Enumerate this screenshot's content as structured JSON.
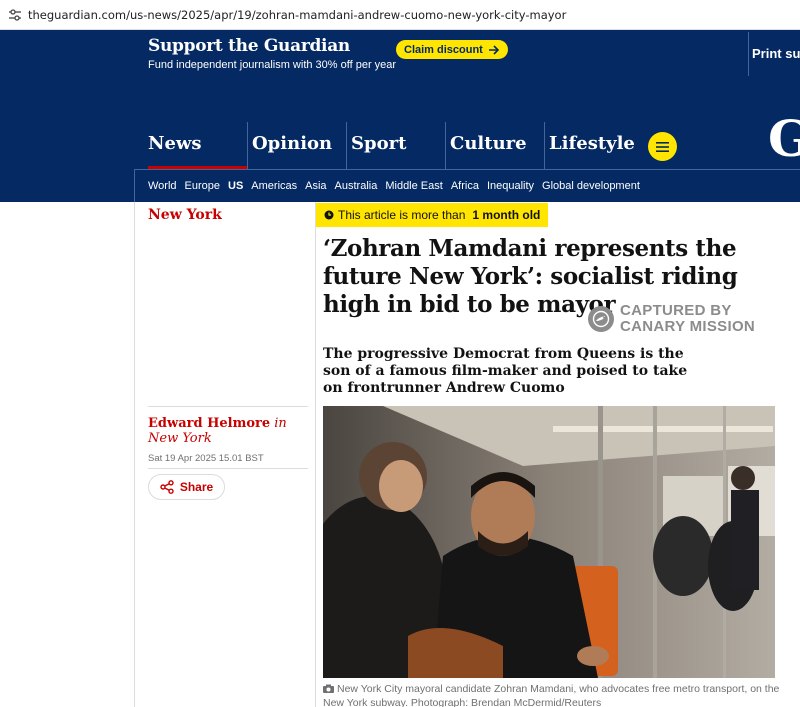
{
  "browser": {
    "url": "theguardian.com/us-news/2025/apr/19/zohran-mamdani-andrew-cuomo-new-york-city-mayor"
  },
  "support_banner": {
    "title": "Support the Guardian",
    "subtitle": "Fund independent journalism with 30% off per year",
    "claim_label": "Claim discount",
    "print_label": "Print sub"
  },
  "nav": {
    "pillars": [
      "News",
      "Opinion",
      "Sport",
      "Culture",
      "Lifestyle"
    ],
    "active_pillar": "News",
    "logo_text": "G",
    "subnav": [
      "World",
      "Europe",
      "US",
      "Americas",
      "Asia",
      "Australia",
      "Middle East",
      "Africa",
      "Inequality",
      "Global development"
    ],
    "active_subnav": "US"
  },
  "article": {
    "section": "New York",
    "age_notice_prefix": "This article is more than",
    "age_notice_bold": "1 month old",
    "headline": "‘Zohran Mamdani represents the future New York’: socialist riding high in bid to be mayor",
    "watermark_line1": "CAPTURED BY",
    "watermark_line2": "CANARY MISSION",
    "standfirst": "The progressive Democrat from Queens is the son of a famous film-maker and poised to take on frontrunner Andrew Cuomo",
    "author": "Edward Helmore",
    "author_location": "in New York",
    "date": "Sat 19 Apr 2025 15.01 BST",
    "share_label": "Share",
    "caption": "New York City mayoral candidate Zohran Mamdani, who advocates free metro transport, on the New York subway. Photograph: Brendan McDermid/Reuters"
  },
  "colors": {
    "brand_blue": "#052962",
    "news_red": "#c70000",
    "highlight_yellow": "#ffe500"
  }
}
